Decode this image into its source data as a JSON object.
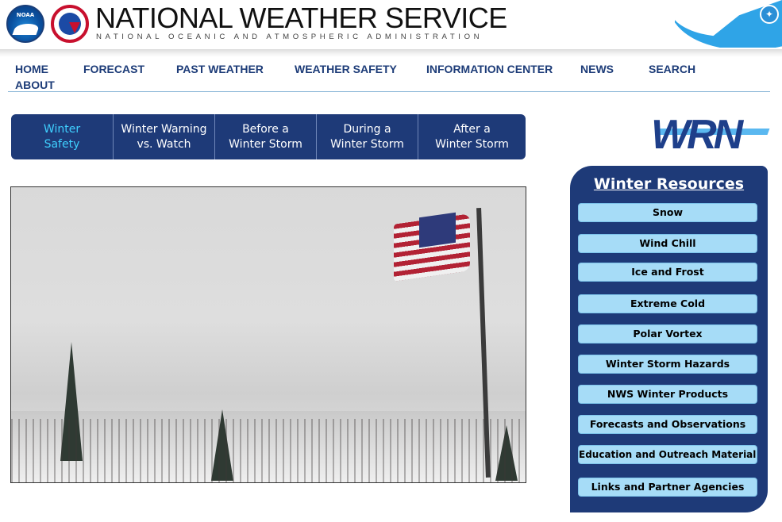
{
  "header": {
    "title": "NATIONAL WEATHER SERVICE",
    "subtitle": "NATIONAL OCEANIC AND ATMOSPHERIC ADMINISTRATION",
    "noaa_logo_text": "NOAA",
    "accent_color": "#2fa4e7"
  },
  "nav": {
    "items": [
      {
        "label": "HOME"
      },
      {
        "label": "FORECAST"
      },
      {
        "label": "PAST WEATHER"
      },
      {
        "label": "WEATHER SAFETY"
      },
      {
        "label": "INFORMATION CENTER"
      },
      {
        "label": "NEWS"
      },
      {
        "label": "SEARCH"
      },
      {
        "label": "ABOUT"
      }
    ]
  },
  "tabs": [
    {
      "label": "Winter\nSafety",
      "active": true
    },
    {
      "label": "Winter Warning\nvs. Watch"
    },
    {
      "label": "Before a\nWinter Storm"
    },
    {
      "label": "During a\nWinter Storm"
    },
    {
      "label": "After a\nWinter Storm"
    }
  ],
  "wrn_logo": "WRN",
  "resources": {
    "title": "Winter Resources",
    "items": [
      {
        "label": "Snow"
      },
      {
        "label": "Wind Chill"
      },
      {
        "label": "Ice and Frost"
      },
      {
        "label": "Extreme Cold"
      },
      {
        "label": "Polar Vortex"
      },
      {
        "label": "Winter Storm Hazards"
      },
      {
        "label": "NWS Winter Products"
      },
      {
        "label": "Forecasts and Observations"
      },
      {
        "label": "Education and Outreach Materials"
      },
      {
        "label": "Links and Partner Agencies"
      }
    ]
  },
  "colors": {
    "nav_text": "#1d3c78",
    "panel_bg": "#1e3a78",
    "button_bg": "#a6dcf7",
    "active_tab_text": "#3fd0ff"
  }
}
